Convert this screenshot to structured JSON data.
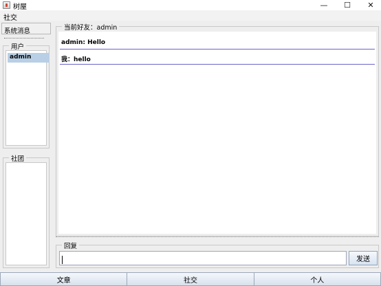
{
  "window": {
    "title": "树屋",
    "minimize": "—",
    "maximize": "☐",
    "close": "✕"
  },
  "menu": {
    "social": "社交"
  },
  "sidebar": {
    "system_tab": "系统消息",
    "users_title": "用户",
    "users": [
      "admin"
    ],
    "groups_title": "社团"
  },
  "chat": {
    "title": "当前好友：admin",
    "messages": [
      {
        "text": "admin: Hello"
      },
      {
        "text": "我：hello"
      }
    ]
  },
  "reply": {
    "title": "回复",
    "input_value": "",
    "send_label": "发送"
  },
  "bottom_tabs": [
    "文章",
    "社交",
    "个人"
  ]
}
